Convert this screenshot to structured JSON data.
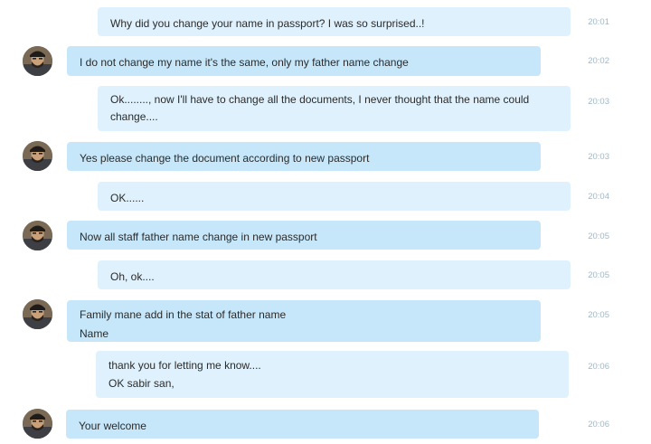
{
  "conversation": {
    "messages": [
      {
        "direction": "outgoing",
        "lines": [
          "Why did you change your name in passport?  I was so surprised..!"
        ],
        "time": "20:01"
      },
      {
        "direction": "incoming",
        "lines": [
          "I do not change my name it's the same, only my father name change"
        ],
        "time": "20:02"
      },
      {
        "direction": "outgoing",
        "lines": [
          "Ok........, now I'll have to change all the documents, I never thought that the name could",
          "change...."
        ],
        "time": "20:03"
      },
      {
        "direction": "incoming",
        "lines": [
          "Yes please change the document according to new passport"
        ],
        "time": "20:03"
      },
      {
        "direction": "outgoing",
        "lines": [
          "OK......"
        ],
        "time": "20:04"
      },
      {
        "direction": "incoming",
        "lines": [
          "Now all staff father name change in new passport"
        ],
        "time": "20:05"
      },
      {
        "direction": "outgoing",
        "lines": [
          "Oh, ok...."
        ],
        "time": "20:05"
      },
      {
        "direction": "incoming",
        "lines": [
          "Family mane add in the stat  of father name",
          "Name"
        ],
        "time": "20:05"
      },
      {
        "direction": "outgoing",
        "lines": [
          "thank you for letting me know....",
          "OK sabir san,"
        ],
        "time": "20:06"
      },
      {
        "direction": "incoming",
        "lines": [
          "Your welcome"
        ],
        "time": "20:06"
      }
    ]
  },
  "colors": {
    "incoming_bubble": "#c6e7fa",
    "outgoing_bubble": "#dff1fc",
    "timestamp": "#9fb8c8"
  },
  "icons": {
    "avatar": "contact-avatar-photo"
  }
}
